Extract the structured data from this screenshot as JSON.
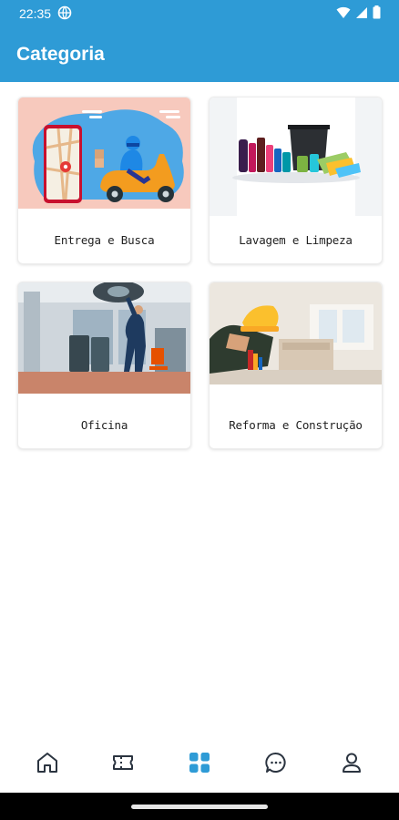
{
  "status": {
    "time": "22:35",
    "icons": [
      "vpn-globe-icon",
      "wifi-icon",
      "cell-signal-icon",
      "battery-icon"
    ]
  },
  "header": {
    "title": "Categoria"
  },
  "categories": [
    {
      "label": "Entrega e Busca",
      "image": "delivery-scooter-illustration"
    },
    {
      "label": "Lavagem e Limpeza",
      "image": "cleaning-products-photo"
    },
    {
      "label": "Oficina",
      "image": "mechanic-garage-photo"
    },
    {
      "label": "Reforma e Construção",
      "image": "construction-renovation-photo"
    }
  ],
  "bottom_nav": {
    "items": [
      "home-icon",
      "ticket-icon",
      "categories-grid-icon",
      "chat-icon",
      "profile-icon"
    ],
    "active": "categories-grid-icon"
  },
  "colors": {
    "primary": "#2e9bd6",
    "inactive_icon": "#2b3440"
  }
}
